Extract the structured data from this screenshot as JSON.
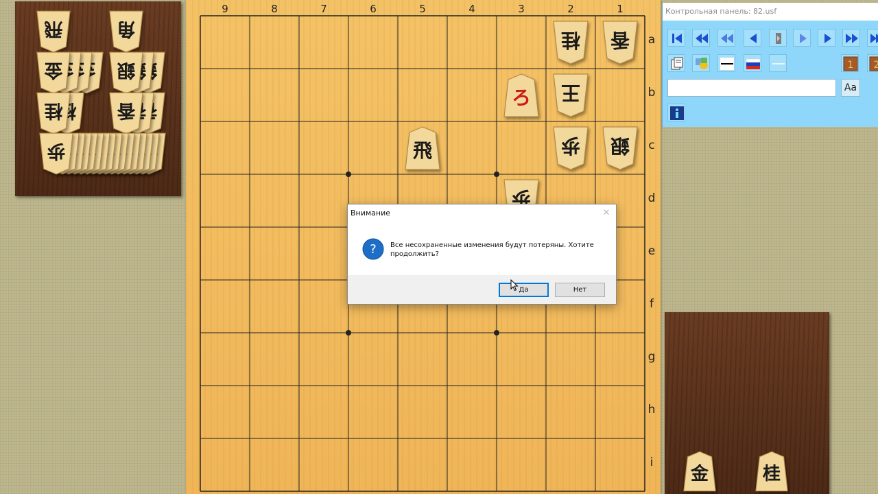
{
  "app": {
    "panel_title": "Контрольная панель: 82.usf"
  },
  "board": {
    "files": [
      "9",
      "8",
      "7",
      "6",
      "5",
      "4",
      "3",
      "2",
      "1"
    ],
    "ranks": [
      "a",
      "b",
      "c",
      "d",
      "e",
      "f",
      "g",
      "h",
      "i"
    ],
    "colors": {
      "wood": "#efb558",
      "lines": "#222222"
    },
    "pieces": [
      {
        "char": "香",
        "file": "1",
        "rank": "a",
        "owner": "gote",
        "promoted": false
      },
      {
        "char": "桂",
        "file": "2",
        "rank": "a",
        "owner": "gote",
        "promoted": false
      },
      {
        "char": "王",
        "file": "2",
        "rank": "b",
        "owner": "gote",
        "promoted": false
      },
      {
        "char": "ろ",
        "file": "3",
        "rank": "b",
        "owner": "sente",
        "promoted": true
      },
      {
        "char": "銀",
        "file": "1",
        "rank": "c",
        "owner": "gote",
        "promoted": false
      },
      {
        "char": "歩",
        "file": "2",
        "rank": "c",
        "owner": "gote",
        "promoted": false
      },
      {
        "char": "飛",
        "file": "5",
        "rank": "c",
        "owner": "sente",
        "promoted": false
      },
      {
        "char": "歩",
        "file": "3",
        "rank": "d",
        "owner": "gote",
        "promoted": false
      }
    ]
  },
  "hands": {
    "gote": [
      {
        "char": "飛",
        "count": 1
      },
      {
        "char": "角",
        "count": 1
      },
      {
        "char": "金",
        "count": 4
      },
      {
        "char": "銀",
        "count": 3
      },
      {
        "char": "桂",
        "count": 2
      },
      {
        "char": "香",
        "count": 3
      },
      {
        "char": "歩",
        "count": 16
      }
    ],
    "sente": [
      {
        "char": "金",
        "count": 1
      },
      {
        "char": "桂",
        "count": 1
      }
    ]
  },
  "panel": {
    "nav_buttons": [
      "first-icon",
      "back-fast-icon",
      "back-variation-icon",
      "back-icon",
      "flip-icon",
      "play-icon",
      "forward-icon",
      "forward-fast-icon",
      "last-icon"
    ],
    "tool_buttons": [
      "notes-icon",
      "shapes-icon",
      "line-icon",
      "russian-flag-icon",
      "minus-icon",
      "move-1-icon",
      "move-2-icon"
    ],
    "input_value": "",
    "font_button_label": "Aa",
    "info_button": "info-icon"
  },
  "dialog": {
    "title": "Внимание",
    "message": "Все несохраненные изменения будут потеряны. Хотите продолжить?",
    "yes_label": "Да",
    "no_label": "Нет",
    "icon": "question-icon",
    "close_icon": "close-icon"
  }
}
